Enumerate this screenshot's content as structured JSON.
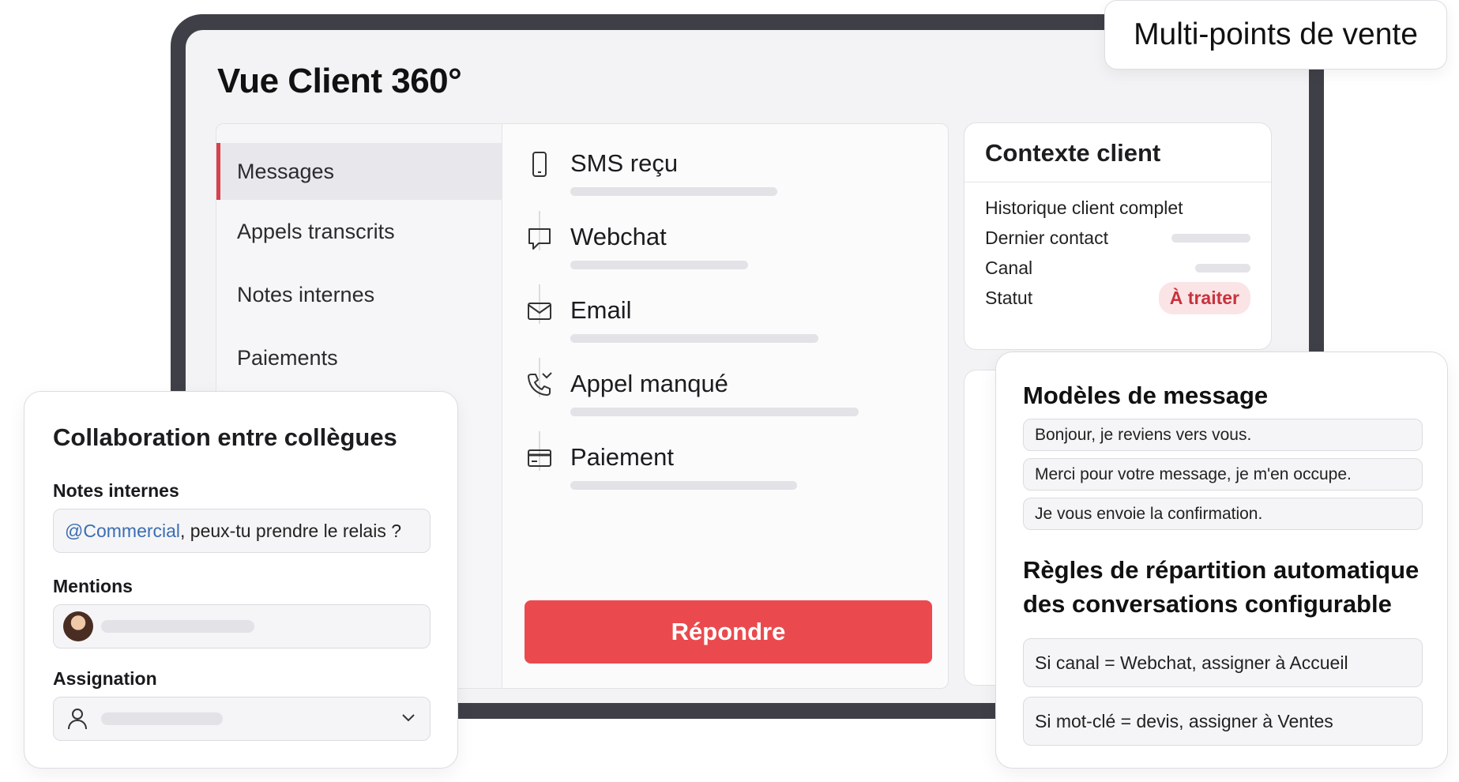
{
  "screen": {
    "title": "Vue Client 360°"
  },
  "badge_top": "Multi-points de vente",
  "menu": {
    "items": [
      {
        "label": "Messages",
        "active": true
      },
      {
        "label": "Appels transcrits",
        "active": false
      },
      {
        "label": "Notes internes",
        "active": false
      },
      {
        "label": "Paiements",
        "active": false
      }
    ]
  },
  "timeline": {
    "items": [
      {
        "label": "SMS reçu",
        "icon": "phone-icon"
      },
      {
        "label": "Webchat",
        "icon": "chat-bubble-icon"
      },
      {
        "label": "Email",
        "icon": "envelope-icon"
      },
      {
        "label": "Appel manqué",
        "icon": "missed-call-icon"
      },
      {
        "label": "Paiement",
        "icon": "credit-card-icon"
      }
    ],
    "reply_label": "Répondre"
  },
  "context": {
    "title": "Contexte client",
    "history": "Historique client complet",
    "last_contact": "Dernier contact",
    "channel": "Canal",
    "status_label": "Statut",
    "status_value": "À traiter",
    "status_color": "#c8323c"
  },
  "collab": {
    "title": "Collaboration entre collègues",
    "notes_label": "Notes internes",
    "note_mention": "@Commercial",
    "note_text": ", peux-tu prendre le relais ?",
    "mentions_label": "Mentions",
    "assign_label": "Assignation"
  },
  "templates": {
    "title": "Modèles de message",
    "items": [
      "Bonjour, je reviens vers vous.",
      "Merci pour votre message, je m'en occupe.",
      "Je vous envoie la confirmation."
    ],
    "rules_title": "Règles de répartition automatique",
    "rules_title_2": "des conversations configurable",
    "rules": [
      "Si canal = Webchat, assigner à Accueil",
      "Si mot-clé = devis, assigner à Ventes"
    ]
  },
  "colors": {
    "accent": "#ea4a4e",
    "menu_active": "#d9404b",
    "device": "#3f4047"
  }
}
